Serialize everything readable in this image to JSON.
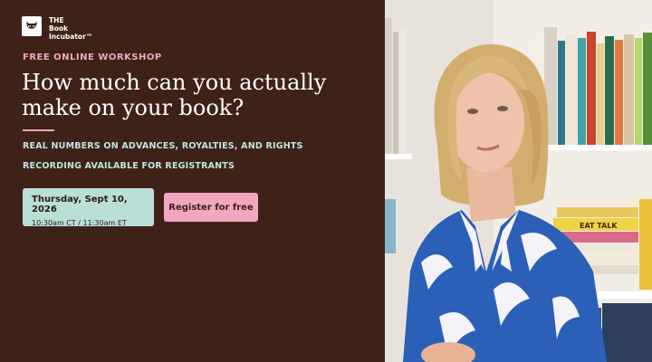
{
  "brand": {
    "line1": "THE",
    "line2": "Book",
    "line3": "Incubator™",
    "logo_icon": "raccoon-icon"
  },
  "hero": {
    "eyebrow": "FREE ONLINE WORKSHOP",
    "headline": "How much can you actually make on your book?",
    "subline_1": "REAL NUMBERS ON ADVANCES, ROYALTIES, AND RIGHTS",
    "subline_2": "RECORDING AVAILABLE FOR REGISTRANTS"
  },
  "event": {
    "date": "Thursday, Sept 10, 2026",
    "time": "10:30am CT / 11:30am ET"
  },
  "cta": {
    "register_label": "Register for free"
  },
  "colors": {
    "background": "#3f2217",
    "accent_pink": "#f2a6c0",
    "accent_mint": "#b9dfd7",
    "subline_text": "#bfe5e3"
  },
  "spine_text": [
    "EAT TALK"
  ]
}
